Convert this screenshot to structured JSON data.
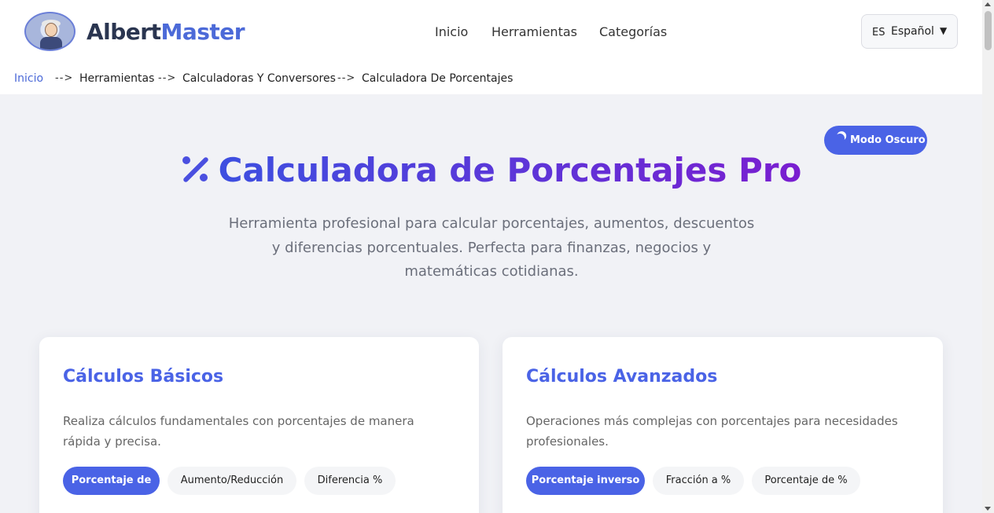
{
  "header": {
    "brand_part1": "Albert",
    "brand_part2": "Master",
    "nav": [
      "Inicio",
      "Herramientas",
      "Categorías"
    ],
    "language": {
      "code": "ES",
      "name": "Español",
      "arrow": "▼"
    }
  },
  "breadcrumb": {
    "items": [
      "Inicio",
      "Herramientas",
      "Calculadoras Y Conversores",
      "Calculadora De Porcentajes"
    ],
    "separator": "-->"
  },
  "dark_mode_button": "Modo Oscuro",
  "hero": {
    "title": "Calculadora de Porcentajes Pro",
    "subtitle": "Herramienta profesional para calcular porcentajes, aumentos, descuentos y diferencias porcentuales. Perfecta para finanzas, negocios y matemáticas cotidianas."
  },
  "cards": [
    {
      "title": "Cálculos Básicos",
      "description": "Realiza cálculos fundamentales con porcentajes de manera rápida y precisa.",
      "tabs": [
        "Porcentaje de",
        "Aumento/Reducción",
        "Diferencia %"
      ],
      "active_tab": 0
    },
    {
      "title": "Cálculos Avanzados",
      "description": "Operaciones más complejas con porcentajes para necesidades profesionales.",
      "tabs": [
        "Porcentaje inverso",
        "Fracción a %",
        "Porcentaje de %"
      ],
      "active_tab": 0
    }
  ],
  "colors": {
    "accent": "#4a63e6",
    "title_gradient_start": "#3d4fe0",
    "title_gradient_end": "#7a1ed0",
    "page_bg": "#f1f2f6"
  }
}
